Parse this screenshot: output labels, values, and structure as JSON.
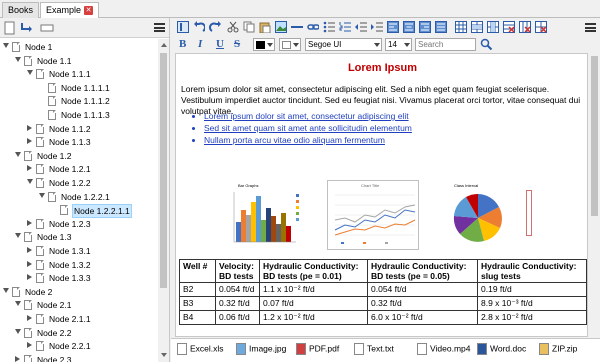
{
  "tabs": [
    {
      "label": "Books"
    },
    {
      "label": "Example"
    }
  ],
  "tree": [
    {
      "label": "Node 1",
      "level": 0,
      "state": "open"
    },
    {
      "label": "Node 1.1",
      "level": 1,
      "state": "open"
    },
    {
      "label": "Node 1.1.1",
      "level": 2,
      "state": "open"
    },
    {
      "label": "Node 1.1.1.1",
      "level": 3,
      "state": "leaf"
    },
    {
      "label": "Node 1.1.1.2",
      "level": 3,
      "state": "leaf"
    },
    {
      "label": "Node 1.1.1.3",
      "level": 3,
      "state": "leaf"
    },
    {
      "label": "Node 1.1.2",
      "level": 2,
      "state": "closed"
    },
    {
      "label": "Node 1.1.3",
      "level": 2,
      "state": "closed"
    },
    {
      "label": "Node 1.2",
      "level": 1,
      "state": "open"
    },
    {
      "label": "Node 1.2.1",
      "level": 2,
      "state": "closed"
    },
    {
      "label": "Node 1.2.2",
      "level": 2,
      "state": "open"
    },
    {
      "label": "Node 1.2.2.1",
      "level": 3,
      "state": "open"
    },
    {
      "label": "Node 1.2.2.1.1",
      "level": 4,
      "state": "leaf",
      "selected": true
    },
    {
      "label": "Node 1.2.3",
      "level": 2,
      "state": "closed"
    },
    {
      "label": "Node 1.3",
      "level": 1,
      "state": "open"
    },
    {
      "label": "Node 1.3.1",
      "level": 2,
      "state": "closed"
    },
    {
      "label": "Node 1.3.2",
      "level": 2,
      "state": "closed"
    },
    {
      "label": "Node 1.3.3",
      "level": 2,
      "state": "closed"
    },
    {
      "label": "Node 2",
      "level": 0,
      "state": "open"
    },
    {
      "label": "Node 2.1",
      "level": 1,
      "state": "open"
    },
    {
      "label": "Node 2.1.1",
      "level": 2,
      "state": "closed"
    },
    {
      "label": "Node 2.2",
      "level": 1,
      "state": "open"
    },
    {
      "label": "Node 2.2.1",
      "level": 2,
      "state": "closed"
    },
    {
      "label": "Node 2.3",
      "level": 1,
      "state": "closed"
    }
  ],
  "format": {
    "bold": "B",
    "italic": "I",
    "underline": "U",
    "strike": "S",
    "font": "Segoe UI",
    "size": "14",
    "search_placeholder": "Search"
  },
  "doc": {
    "title": "Lorem Ipsum",
    "paragraph": "Lorem ipsum dolor sit amet, consectetur adipiscing elit. Sed a nibh eget quam feugiat scelerisque. Vestibulum imperdiet auctor tincidunt. Sed eu feugiat nisi. Vivamus placerat orci tortor, vitae consequat dui volutpat vitae.",
    "links": [
      "Lorem ipsum dolor sit amet, consectetur adipiscing elit",
      "Sed sit amet quam sit amet ante sollicitudin elementum",
      "Nullam porta arcu vitae odio aliquam fermentum"
    ],
    "charts": {
      "bar": "Bar Graphs",
      "line": "Chart Title",
      "pie": "Class Interval"
    },
    "table": {
      "headers": [
        "Well #",
        "Velocity: BD tests",
        "Hydraulic Conductivity: BD tests (pe = 0.01)",
        "Hydraulic Conductivity: BD tests (pe = 0.05)",
        "Hydraulic Conductivity: slug tests"
      ],
      "rows": [
        [
          "B2",
          "0.054 ft/d",
          "1.1 x 10⁻² ft/d",
          "0.054 ft/d",
          "0.19 ft/d"
        ],
        [
          "B3",
          "0.32 ft/d",
          "0.07 ft/d",
          "0.32 ft/d",
          "8.9 x 10⁻³ ft/d"
        ],
        [
          "B4",
          "0.06 ft/d",
          "1.2 x 10⁻² ft/d",
          "6.0 x 10⁻² ft/d",
          "2.8 x 10⁻² ft/d"
        ]
      ]
    }
  },
  "attachments": [
    "Excel.xls",
    "Image.jpg",
    "PDF.pdf",
    "Text.txt",
    "Video.mp4",
    "Word.doc",
    "ZIP.zip"
  ],
  "colors": {
    "accent": "#2a5caa",
    "title": "#c00000",
    "link": "#1f3fbf",
    "selection": "#cce8ff"
  }
}
